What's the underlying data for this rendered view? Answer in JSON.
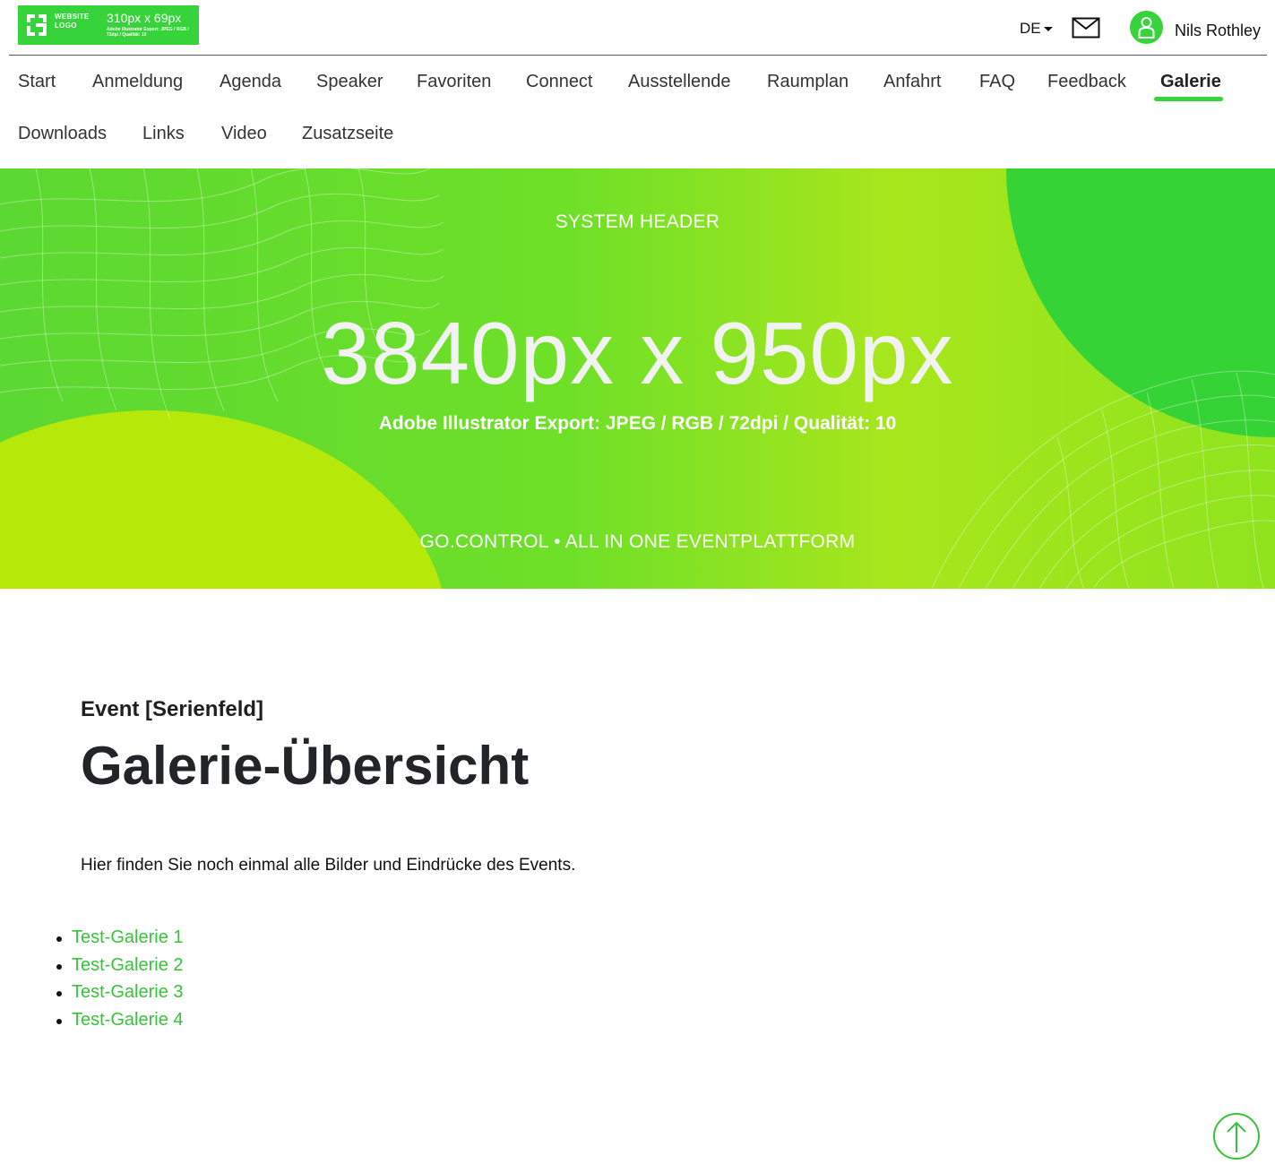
{
  "brand": {
    "logo_small_text": "WEBSITE LOGO",
    "logo_size": "310px x 69px",
    "logo_meta": "Adobe Illustrator Export: JPEG / RGB / 72dpi / Qualität: 10",
    "accent": "#37d33a"
  },
  "header": {
    "language": "DE",
    "mail_icon": "mail-icon",
    "user_icon": "user-icon",
    "user_name": "Nils Rothley"
  },
  "nav": {
    "items": [
      {
        "label": "Start"
      },
      {
        "label": "Anmeldung"
      },
      {
        "label": "Agenda"
      },
      {
        "label": "Speaker"
      },
      {
        "label": "Favoriten"
      },
      {
        "label": "Connect"
      },
      {
        "label": "Ausstellende"
      },
      {
        "label": "Raumplan"
      },
      {
        "label": "Anfahrt"
      },
      {
        "label": "FAQ"
      },
      {
        "label": "Feedback"
      },
      {
        "label": "Galerie",
        "active": true
      },
      {
        "label": "Downloads"
      },
      {
        "label": "Links"
      },
      {
        "label": "Video"
      },
      {
        "label": "Zusatzseite"
      }
    ]
  },
  "hero": {
    "top_text": "SYSTEM HEADER",
    "size_text": "3840px x 950px",
    "meta_text": "Adobe Illustrator Export: JPEG / RGB / 72dpi / Qualität: 10",
    "bottom_text": "GO.CONTROL • ALL IN ONE EVENTPLATTFORM"
  },
  "content": {
    "eyebrow": "Event [Serienfeld]",
    "title": "Galerie-Übersicht",
    "intro": "Hier finden Sie noch einmal alle Bilder und Eindrücke des Events.",
    "galleries": [
      "Test-Galerie 1",
      "Test-Galerie 2",
      "Test-Galerie 3",
      "Test-Galerie 4"
    ]
  },
  "scroll_top_icon": "arrow-up-icon"
}
